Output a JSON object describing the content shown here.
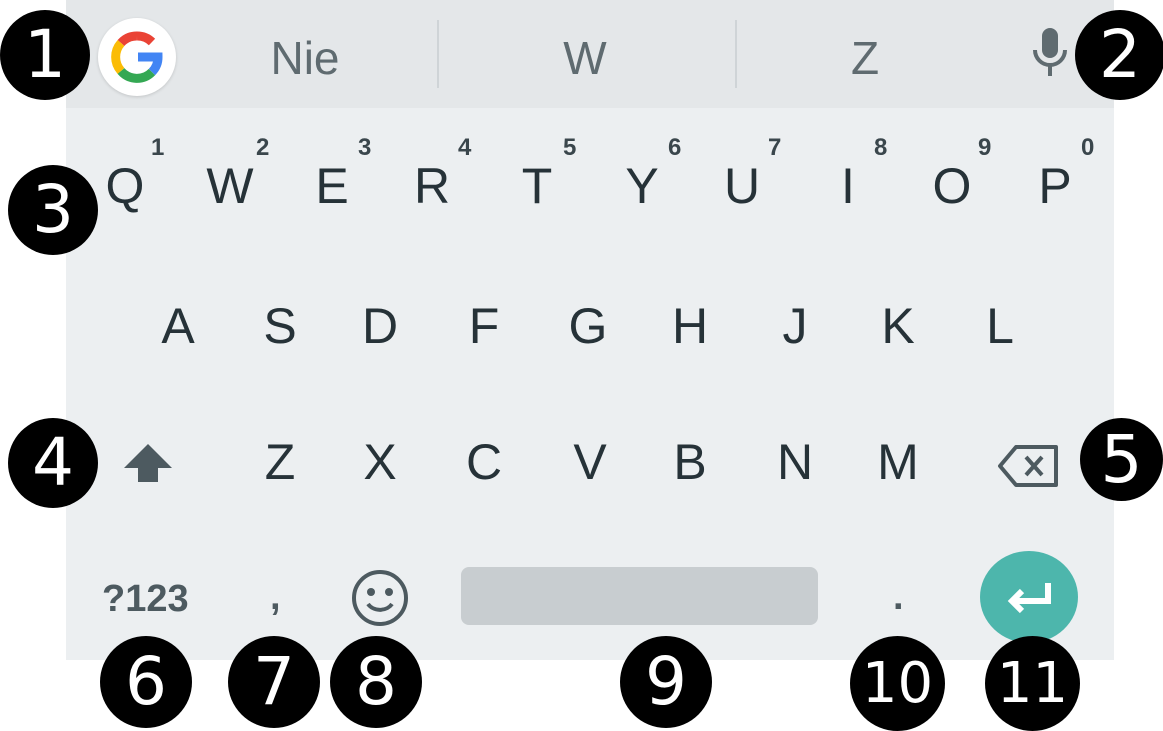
{
  "suggestions": [
    "Nie",
    "W",
    "Z"
  ],
  "rows": {
    "row1": [
      "Q",
      "W",
      "E",
      "R",
      "T",
      "Y",
      "U",
      "I",
      "O",
      "P"
    ],
    "row1_hints": [
      "1",
      "2",
      "3",
      "4",
      "5",
      "6",
      "7",
      "8",
      "9",
      "0"
    ],
    "row2": [
      "A",
      "S",
      "D",
      "F",
      "G",
      "H",
      "J",
      "K",
      "L"
    ],
    "row3": [
      "Z",
      "X",
      "C",
      "V",
      "B",
      "N",
      "M"
    ]
  },
  "bottom_row": {
    "symbols_label": "?123",
    "comma_label": ",",
    "period_label": "."
  },
  "icons": {
    "google": "google-g-icon",
    "mic": "microphone-icon",
    "shift": "shift-arrow-icon",
    "backspace": "backspace-icon",
    "emoji": "smiley-icon",
    "enter": "enter-arrow-icon"
  },
  "badges": [
    "1",
    "2",
    "3",
    "4",
    "5",
    "6",
    "7",
    "8",
    "9",
    "10",
    "11"
  ],
  "colors": {
    "keyboard_bg": "#eceff1",
    "suggestion_bar_bg": "#e4e7e9",
    "enter_accent": "#4db6ac",
    "key_text": "#263238"
  }
}
